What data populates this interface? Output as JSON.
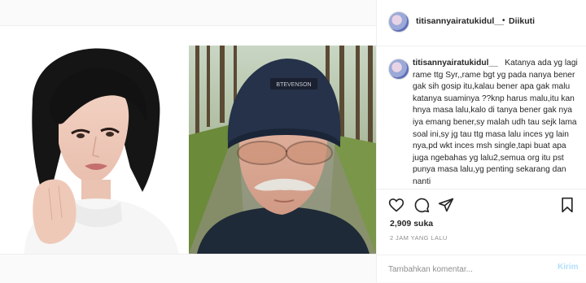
{
  "post": {
    "username": "titisannyairatukidul__",
    "follow_separator": "•",
    "follow_label": "Diikuti",
    "caption_username": "titisannyairatukidul__",
    "caption_text": "Katanya ada yg lagi rame ttg Syr,,rame bgt yg pada nanya bener gak sih gosip itu,kalau bener apa gak malu katanya suaminya ??knp harus malu,itu kan hnya masa lalu,kalo di tanya bener gak nya iya emang bener,sy malah udh tau sejk lama soal ini,sy jg tau ttg masa lalu inces yg lain nya,pd wkt inces msh single,tapi buat apa juga ngebahas yg lalu2,semua org itu pst punya masa lalu,yg penting sekarang dan nanti",
    "likes": "2,909 suka",
    "time": "2 JAM YANG LALU",
    "comment_placeholder": "Tambahkan komentar...",
    "post_button": "Kirim",
    "beanie_text": "BTEVENSON"
  },
  "icons": {
    "like": "heart-icon",
    "comment": "comment-icon",
    "share": "paper-plane-icon",
    "save": "bookmark-icon"
  },
  "colors": {
    "post_button": "#b2dffc",
    "meta": "#8e8e8e",
    "text": "#262626"
  }
}
